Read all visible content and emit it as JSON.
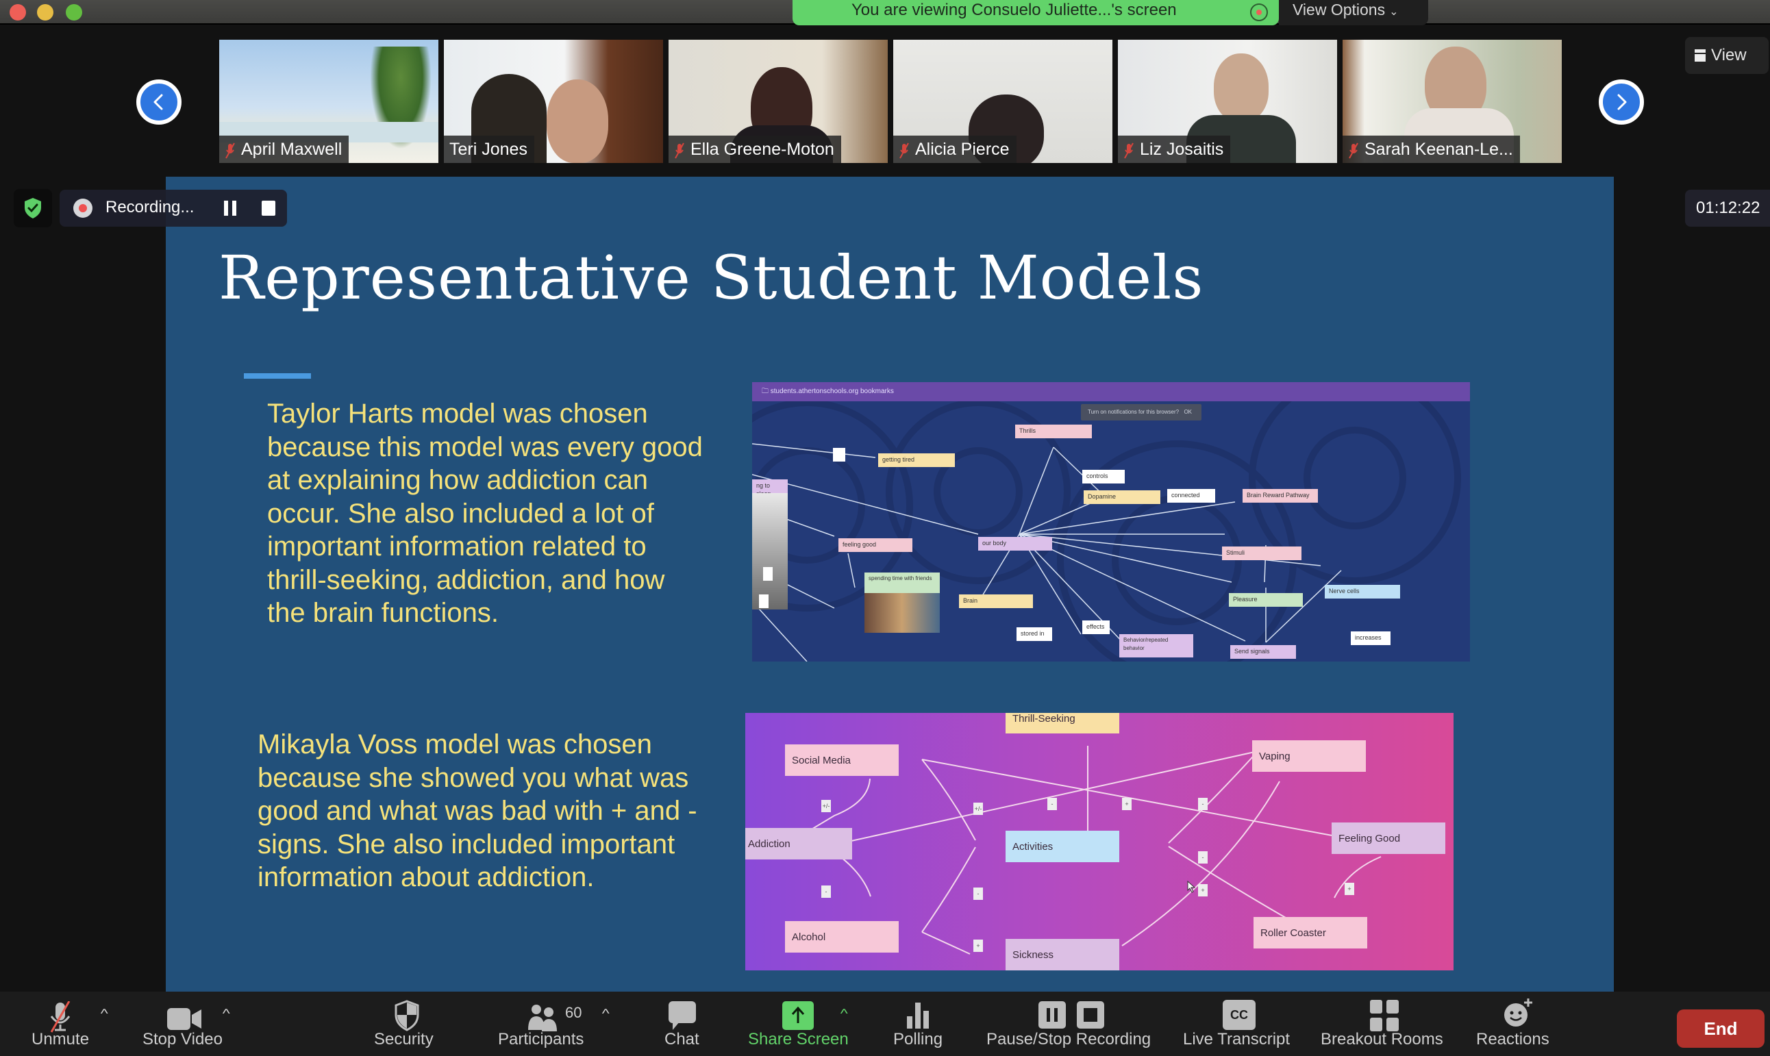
{
  "window": {
    "share_banner": "You are viewing Consuelo Juliette...'s screen",
    "view_options": "View Options"
  },
  "gallery": {
    "prev_icon": "chevron-left-icon",
    "next_icon": "chevron-right-icon",
    "view_button": "View",
    "participants": [
      {
        "name": "April Maxwell",
        "muted": true
      },
      {
        "name": "Teri Jones",
        "muted": false
      },
      {
        "name": "Ella Greene-Moton",
        "muted": true
      },
      {
        "name": "Alicia Pierce",
        "muted": true
      },
      {
        "name": "Liz Josaitis",
        "muted": true
      },
      {
        "name": "Sarah Keenan-Le...",
        "muted": true
      }
    ]
  },
  "recording": {
    "label": "Recording...",
    "timer": "01:12:22"
  },
  "slide": {
    "title": "Representative Student Models",
    "paragraph1": "Taylor Harts model was chosen because this model was every good at explaining how addiction can occur. She also included a lot of important information related to thrill-seeking, addiction, and how the brain functions.",
    "paragraph2": "Mikayla Voss model was chosen because she showed you what was good and what was bad with + and - signs. She also included important information about addiction.",
    "colors": {
      "background": "#22507a",
      "text": "#f6e27a",
      "title": "#ffffff",
      "accent": "#4a9ae0"
    },
    "model1": {
      "browser_bar": "students.athertonschools.org bookmarks",
      "notification": "Turn on notifications for this browser?",
      "notification_ok": "OK",
      "nodes": {
        "thrills": "Thrills",
        "getting_tired": "getting tired",
        "controls": "controls",
        "dopamine": "Dopamine",
        "connected": "connected",
        "brain_reward": "Brain Reward Pathway",
        "to_sleep": "ng to sleep",
        "feeling_good": "feeling good",
        "our_body": "our body",
        "stimuli": "Stimuli",
        "nerve_cells": "Nerve cells",
        "pleasure": "Pleasure",
        "spending_time": "spending time with friends",
        "brain": "Brain",
        "effects": "effects",
        "stored_in": "stored in",
        "behavior": "Behavior/repeated behavior",
        "send_signals": "Send signals",
        "increases": "increases"
      }
    },
    "model2": {
      "nodes": {
        "thrill_seeking": "Thrill-Seeking",
        "social_media": "Social Media",
        "vaping": "Vaping",
        "addiction": "Addiction",
        "activities": "Activities",
        "feeling_good": "Feeling Good",
        "alcohol": "Alcohol",
        "roller_coaster": "Roller Coaster",
        "sickness": "Sickness"
      },
      "signs": [
        "+/-",
        "+/-",
        "-",
        "+",
        "-",
        "-",
        "+",
        "-",
        "-",
        "+",
        "+"
      ]
    }
  },
  "toolbar": {
    "unmute": "Unmute",
    "stop_video": "Stop Video",
    "security": "Security",
    "participants": "Participants",
    "participants_count": "60",
    "chat": "Chat",
    "share_screen": "Share Screen",
    "polling": "Polling",
    "pause_stop_recording": "Pause/Stop Recording",
    "live_transcript": "Live Transcript",
    "cc": "CC",
    "breakout_rooms": "Breakout Rooms",
    "reactions": "Reactions",
    "end": "End",
    "caret": "^"
  }
}
